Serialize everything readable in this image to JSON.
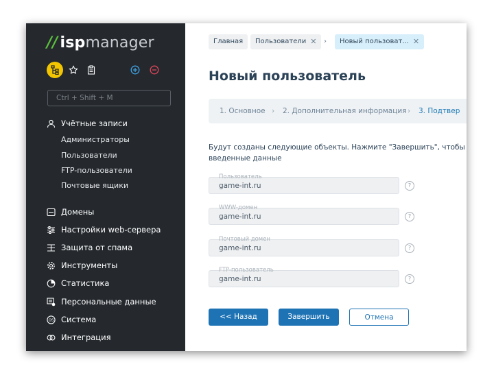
{
  "colors": {
    "sidebar_bg": "#25292e",
    "accent": "#1e73b5",
    "logo_green": "#5bbf3c",
    "quick_access_bg": "#f2c500"
  },
  "logo": {
    "slash": "//",
    "isp": "isp",
    "manager": "manager"
  },
  "sidebar": {
    "quick_actions": [
      {
        "icon": "sitemap-icon"
      },
      {
        "icon": "star-icon"
      },
      {
        "icon": "clipboard-icon"
      },
      {
        "icon": "plus-circle-icon"
      },
      {
        "icon": "minus-circle-icon"
      }
    ],
    "search_placeholder": "Ctrl + Shift + M",
    "accounts": {
      "label": "Учётные записи",
      "items": [
        "Администраторы",
        "Пользователи",
        "FTP-пользователи",
        "Почтовые ящики"
      ]
    },
    "sections": [
      {
        "label": "Домены",
        "icon": "domains-icon"
      },
      {
        "label": "Настройки web-сервера",
        "icon": "sliders-icon"
      },
      {
        "label": "Защита от спама",
        "icon": "spam-shield-icon"
      },
      {
        "label": "Инструменты",
        "icon": "gear-icon"
      },
      {
        "label": "Статистика",
        "icon": "pie-chart-icon"
      },
      {
        "label": "Персональные данные",
        "icon": "personal-data-icon"
      },
      {
        "label": "Система",
        "icon": "os-icon"
      },
      {
        "label": "Интеграция",
        "icon": "integration-icon"
      }
    ]
  },
  "breadcrumbs": {
    "home": "Главная",
    "users": "Пользователи",
    "separator": "›",
    "current": "Новый пользоват..."
  },
  "page": {
    "title": "Новый пользователь",
    "steps": [
      "1. Основное",
      "2. Дополнительная информация",
      "3. Подтвер"
    ],
    "step_separator": "›",
    "info_line1": "Будут созданы следующие объекты. Нажмите \"Завершить\", чтобы",
    "info_line2": "введенные данные",
    "fields": [
      {
        "label": "Пользователь",
        "value": "game-int.ru"
      },
      {
        "label": "WWW-домен",
        "value": "game-int.ru"
      },
      {
        "label": "Почтовый домен",
        "value": "game-int.ru"
      },
      {
        "label": "FTP-пользователь",
        "value": "game-int.ru"
      }
    ],
    "help_glyph": "?",
    "buttons": {
      "back": "<< Назад",
      "finish": "Завершить",
      "cancel": "Отмена"
    }
  }
}
